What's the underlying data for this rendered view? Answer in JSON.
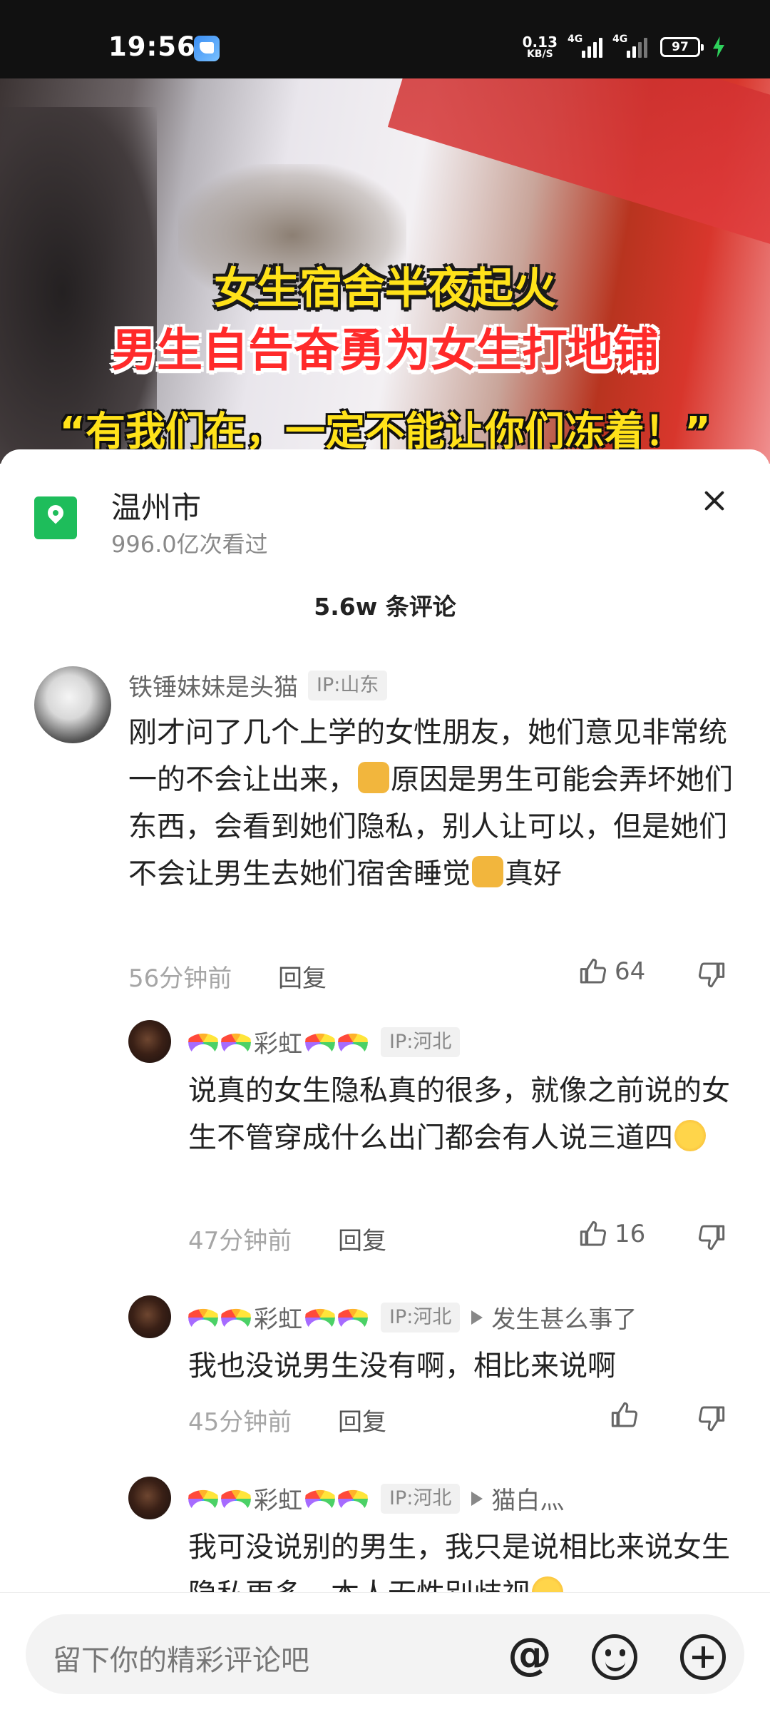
{
  "status_bar": {
    "time": "19:56",
    "net_speed": "0.13",
    "net_unit": "KB/S",
    "signal1": "4G",
    "signal2": "4G",
    "battery": "97"
  },
  "video": {
    "caption_line1": "女生宿舍半夜起火",
    "caption_line2": "男生自告奋勇为女生打地铺",
    "caption_line3": "“有我们在，一定不能让你们冻着！”"
  },
  "location": {
    "name": "温州市",
    "views": "996.0亿次看过"
  },
  "comment_count": "5.6w 条评论",
  "comments": [
    {
      "username": "铁锤妹妹是头猫",
      "ip": "IP:山东",
      "text_parts": [
        "刚才问了几个上学的女性朋友，她们意见非常统一的不会让出来，",
        "原因是男生可能会弄坏她们东西，会看到她们隐私，别人让可以，但是她们不会让男生去她们宿舍睡觉",
        "真好"
      ],
      "time": "56分钟前",
      "reply_label": "回复",
      "likes": "64"
    },
    {
      "username": "彩虹",
      "ip": "IP:河北",
      "text_parts": [
        "说真的女生隐私真的很多，就像之前说的女生不管穿成什么出门都会有人说三道四"
      ],
      "time": "47分钟前",
      "reply_label": "回复",
      "likes": "16"
    },
    {
      "username": "彩虹",
      "ip": "IP:河北",
      "reply_to": "发生甚么事了",
      "text_parts": [
        "我也没说男生没有啊，相比来说啊"
      ],
      "time": "45分钟前",
      "reply_label": "回复",
      "likes": ""
    },
    {
      "username": "彩虹",
      "ip": "IP:河北",
      "reply_to": "猫白灬",
      "text_parts": [
        "我可没说别的男生，我只是说相比来说女生隐私更多，本人无性别歧视"
      ]
    }
  ],
  "input": {
    "placeholder": "留下你的精彩评论吧",
    "at_symbol": "@"
  },
  "icons": {
    "location": "location-pin-icon",
    "close": "close-icon",
    "like": "thumbs-up-icon",
    "dislike": "thumbs-down-icon",
    "emoji": "smile-icon",
    "add": "plus-icon"
  },
  "colors": {
    "location_green": "#1ebd5b",
    "caption_yellow": "#ffe21a",
    "caption_red": "#ff2a2a"
  }
}
